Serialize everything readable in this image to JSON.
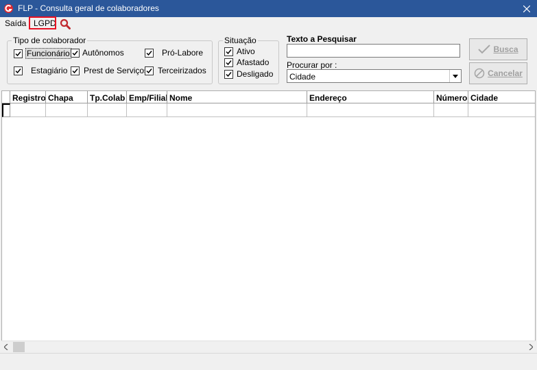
{
  "window": {
    "title": "FLP - Consulta geral de colaboradores",
    "close_label": "✕"
  },
  "menu": {
    "saida": "Saída",
    "lgpd": "LGPD"
  },
  "tipo": {
    "legend": "Tipo de colaborador",
    "items": [
      {
        "label": "Funcionário",
        "checked": true
      },
      {
        "label": "Autônomos",
        "checked": true
      },
      {
        "label": "Pró-Labore",
        "checked": true
      },
      {
        "label": "Estagiário",
        "checked": true
      },
      {
        "label": "Prest de Serviços",
        "checked": true
      },
      {
        "label": "Terceirizados",
        "checked": true
      }
    ]
  },
  "situacao": {
    "legend": "Situação",
    "items": [
      {
        "label": "Ativo",
        "checked": true
      },
      {
        "label": "Afastado",
        "checked": true
      },
      {
        "label": "Desligado",
        "checked": true
      }
    ]
  },
  "search": {
    "title": "Texto a Pesquisar",
    "value": "",
    "procurar_label": "Procurar por :",
    "procurar_value": "Cidade"
  },
  "buttons": {
    "busca": "Busca",
    "cancelar": "Cancelar"
  },
  "grid": {
    "columns": [
      "Registro",
      "Chapa",
      "Tp.Colab",
      "Emp/Filial",
      "Nome",
      "Endereço",
      "Número",
      "Cidade"
    ],
    "rows": []
  }
}
